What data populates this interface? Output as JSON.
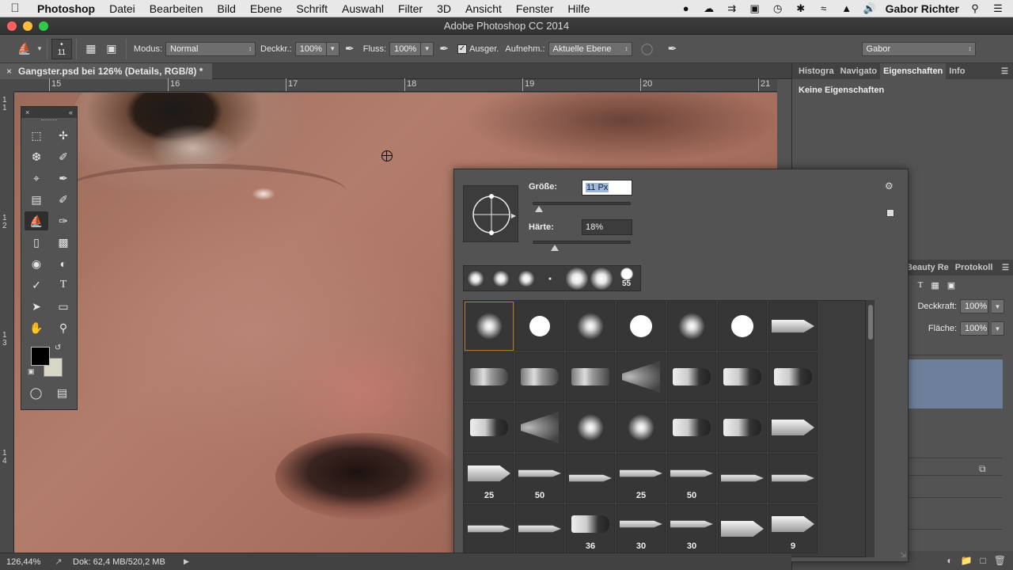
{
  "menubar": {
    "app": "Photoshop",
    "items": [
      "Datei",
      "Bearbeiten",
      "Bild",
      "Ebene",
      "Schrift",
      "Auswahl",
      "Filter",
      "3D",
      "Ansicht",
      "Fenster",
      "Hilfe"
    ],
    "user": "Gabor Richter"
  },
  "window": {
    "title": "Adobe Photoshop CC 2014"
  },
  "options": {
    "brush_size": "11",
    "modus_label": "Modus:",
    "modus_value": "Normal",
    "deckkr_label": "Deckkr.:",
    "deckkr_value": "100%",
    "fluss_label": "Fluss:",
    "fluss_value": "100%",
    "ausger_label": "Ausger.",
    "aufnehm_label": "Aufnehm.:",
    "aufnehm_value": "Aktuelle Ebene",
    "preset_value": "Gabor"
  },
  "document": {
    "tab_title": "Gangster.psd bei 126% (Details, RGB/8) *",
    "ruler_h_labels": [
      "15",
      "16",
      "17",
      "18",
      "19",
      "20",
      "21"
    ],
    "ruler_v_labels": [
      "1\n1",
      "1\n2",
      "1\n3",
      "1\n4"
    ]
  },
  "brush_popup": {
    "size_label": "Größe:",
    "size_value": "11 Px",
    "size_level": 0.02,
    "hardness_label": "Härte:",
    "hardness_value": "18%",
    "hardness_level": 0.18,
    "recent_label": "55",
    "grid_numbers": [
      "25",
      "50",
      "",
      "25",
      "50",
      "",
      "",
      "",
      "",
      "36",
      "30",
      "30",
      "",
      "9"
    ]
  },
  "right_panel": {
    "tabs": [
      "Histogra",
      "Navigato",
      "Eigenschaften",
      "Info"
    ],
    "properties_title": "Keine Eigenschaften",
    "tabs2": [
      "Beauty Re",
      "Protokoll"
    ],
    "deckkraft_label": "Deckkraft:",
    "deckkraft_value": "100%",
    "flaeche_label": "Fläche:",
    "flaeche_value": "100%"
  },
  "status": {
    "zoom": "126,44%",
    "doc": "Dok: 62,4 MB/520,2 MB"
  },
  "colors": {
    "foreground": "#000000",
    "background": "#d8d7c6",
    "layer_selection": "#6e7f9b"
  }
}
